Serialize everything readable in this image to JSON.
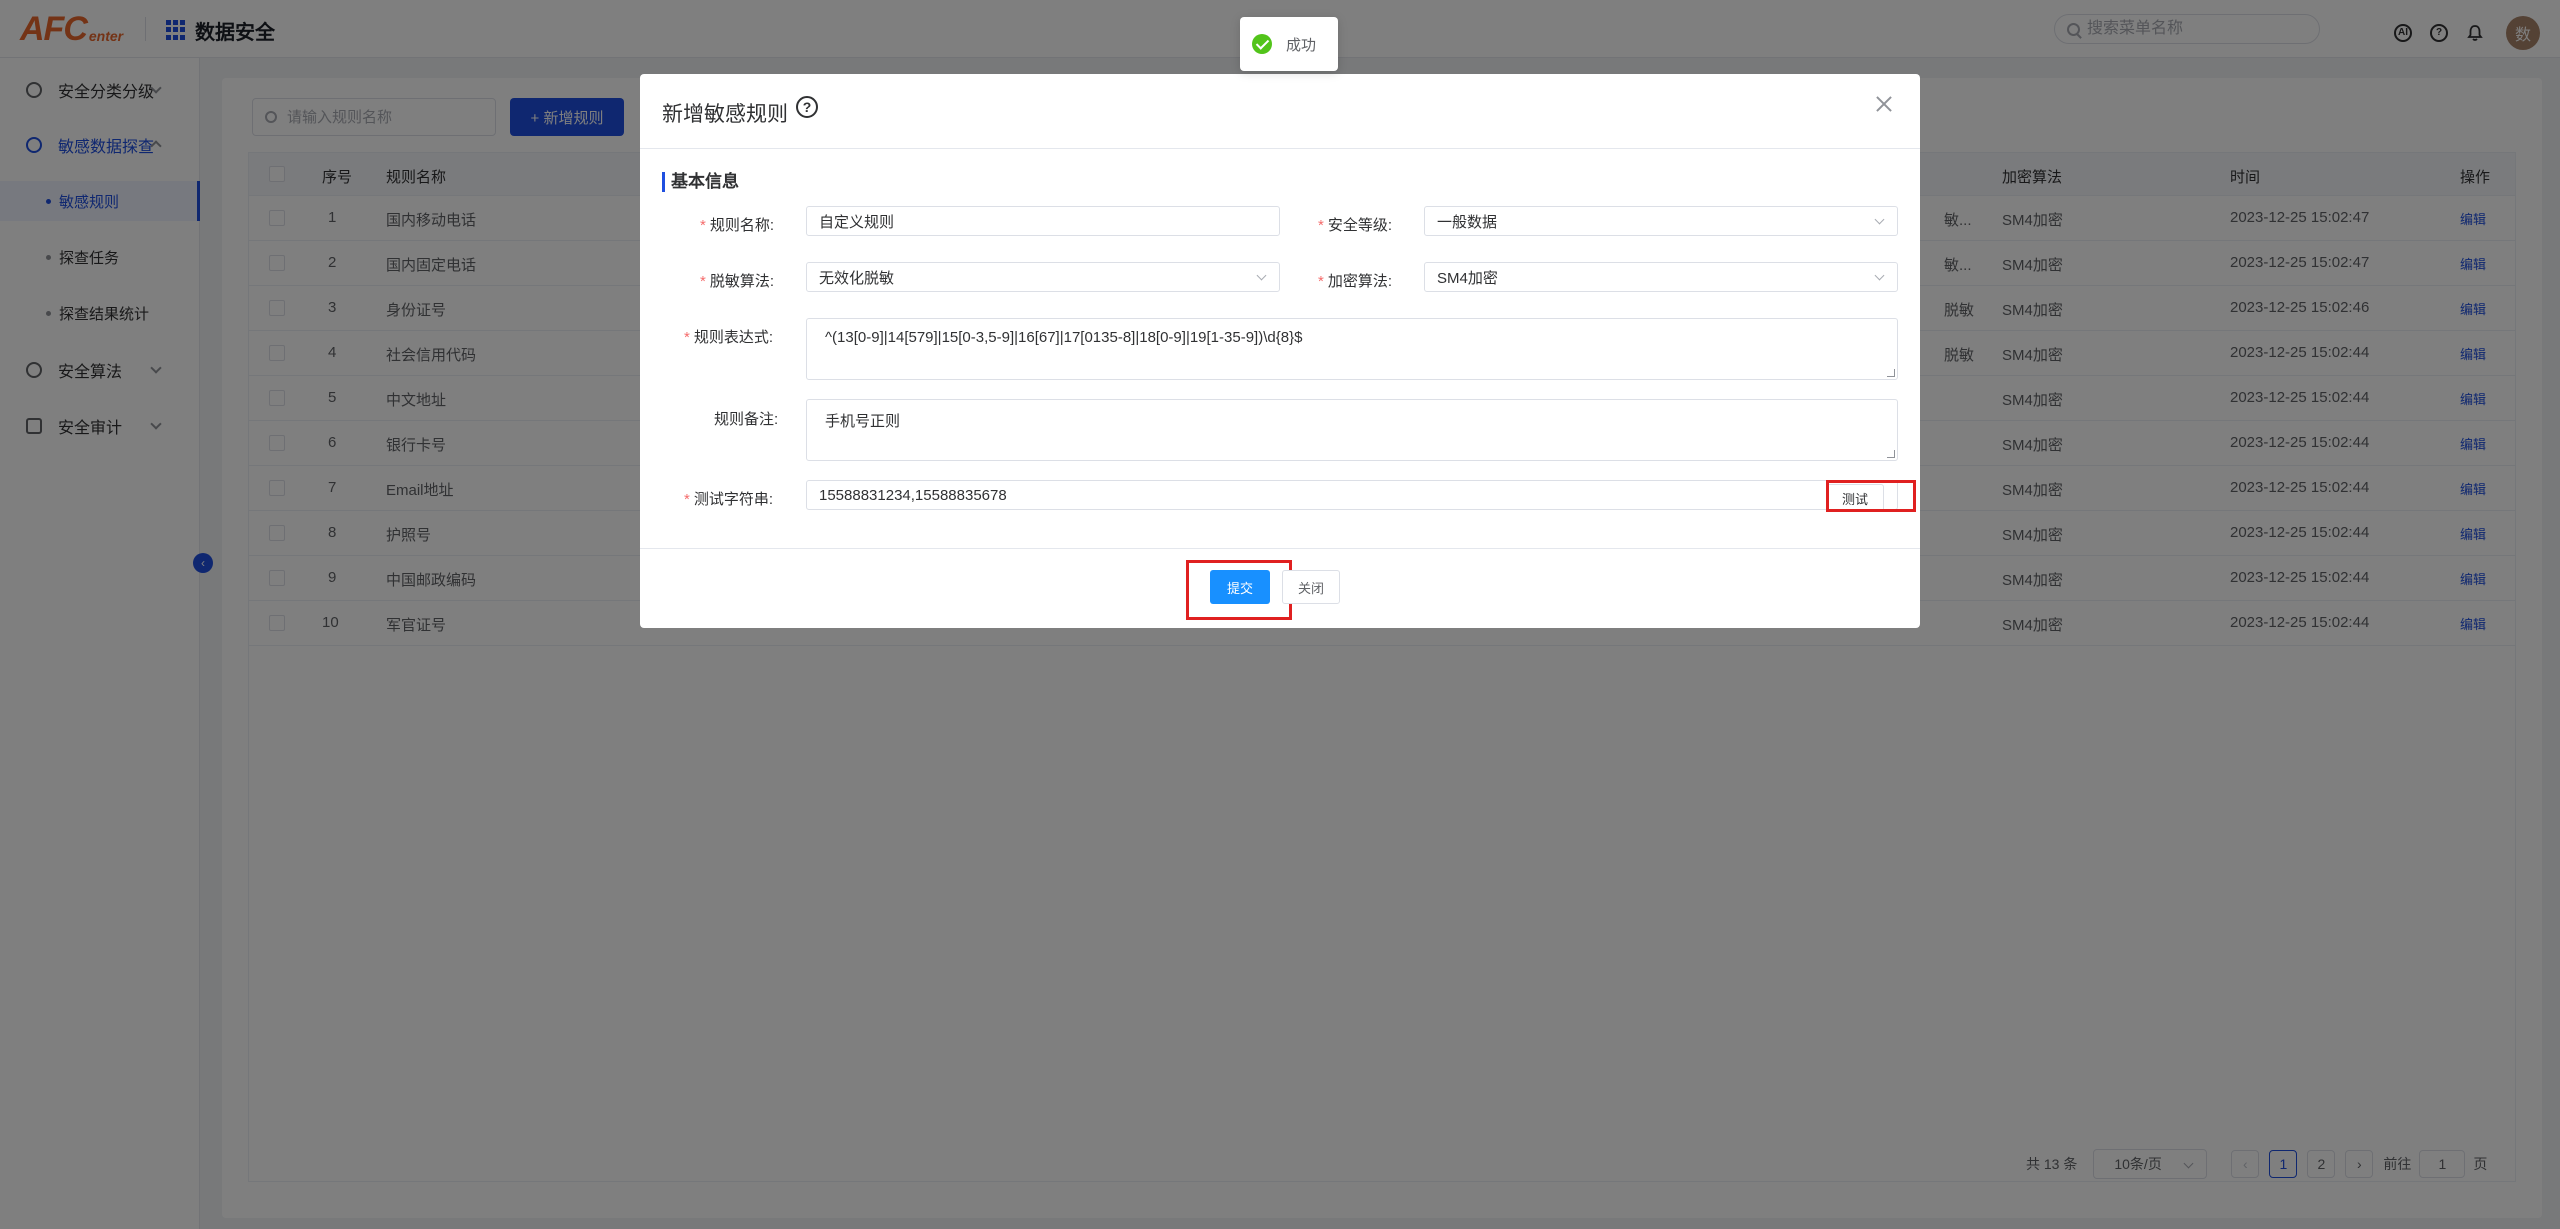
{
  "header": {
    "logo_main": "AFC",
    "logo_sub": "enter",
    "app_title": "数据安全",
    "search_placeholder": "搜索菜单名称",
    "avatar_text": "数"
  },
  "sidebar": {
    "items": [
      {
        "label": "安全分类分级"
      },
      {
        "label": "敏感数据探查"
      },
      {
        "label": "安全算法"
      },
      {
        "label": "安全审计"
      }
    ],
    "subitems": [
      {
        "label": "敏感规则"
      },
      {
        "label": "探查任务"
      },
      {
        "label": "探查结果统计"
      }
    ]
  },
  "toolbar": {
    "search_placeholder": "请输入规则名称",
    "add_label": "+ 新增规则"
  },
  "table": {
    "headers": {
      "index": "序号",
      "name": "规则名称",
      "encrypt": "加密算法",
      "time": "时间",
      "action": "操作"
    },
    "rows": [
      {
        "index": "1",
        "name": "国内移动电话",
        "masking": "敏...",
        "encrypt": "SM4加密",
        "time": "2023-12-25 15:02:47",
        "action": "编辑"
      },
      {
        "index": "2",
        "name": "国内固定电话",
        "masking": "敏...",
        "encrypt": "SM4加密",
        "time": "2023-12-25 15:02:47",
        "action": "编辑"
      },
      {
        "index": "3",
        "name": "身份证号",
        "masking": "脱敏",
        "encrypt": "SM4加密",
        "time": "2023-12-25 15:02:46",
        "action": "编辑"
      },
      {
        "index": "4",
        "name": "社会信用代码",
        "masking": "脱敏",
        "encrypt": "SM4加密",
        "time": "2023-12-25 15:02:44",
        "action": "编辑"
      },
      {
        "index": "5",
        "name": "中文地址",
        "masking": "",
        "encrypt": "SM4加密",
        "time": "2023-12-25 15:02:44",
        "action": "编辑"
      },
      {
        "index": "6",
        "name": "银行卡号",
        "masking": "",
        "encrypt": "SM4加密",
        "time": "2023-12-25 15:02:44",
        "action": "编辑"
      },
      {
        "index": "7",
        "name": "Email地址",
        "masking": "",
        "encrypt": "SM4加密",
        "time": "2023-12-25 15:02:44",
        "action": "编辑"
      },
      {
        "index": "8",
        "name": "护照号",
        "masking": "",
        "encrypt": "SM4加密",
        "time": "2023-12-25 15:02:44",
        "action": "编辑"
      },
      {
        "index": "9",
        "name": "中国邮政编码",
        "masking": "",
        "encrypt": "SM4加密",
        "time": "2023-12-25 15:02:44",
        "action": "编辑"
      },
      {
        "index": "10",
        "name": "军官证号",
        "masking": "",
        "encrypt": "SM4加密",
        "time": "2023-12-25 15:02:44",
        "action": "编辑"
      }
    ]
  },
  "pagination": {
    "total": "共 13 条",
    "page_size": "10条/页",
    "pages": [
      "1",
      "2"
    ],
    "current": "1",
    "goto_label": "前往",
    "goto_value": "1",
    "page_suffix": "页"
  },
  "dialog": {
    "title": "新增敏感规则",
    "section": "基本信息",
    "fields": {
      "rule_name": {
        "label": "规则名称:",
        "value": "自定义规则"
      },
      "security_level": {
        "label": "安全等级:",
        "value": "一般数据"
      },
      "masking_algo": {
        "label": "脱敏算法:",
        "value": "无效化脱敏"
      },
      "encrypt_algo": {
        "label": "加密算法:",
        "value": "SM4加密"
      },
      "regex": {
        "label": "规则表达式:",
        "value": "^(13[0-9]|14[579]|15[0-3,5-9]|16[67]|17[0135-8]|18[0-9]|19[1-35-9])\\d{8}$"
      },
      "remark": {
        "label": "规则备注:",
        "value": "手机号正则"
      },
      "test_string": {
        "label": "测试字符串:",
        "value": "15588831234,15588835678"
      }
    },
    "test_button": "测试",
    "submit_button": "提交",
    "close_button": "关闭"
  },
  "toast": {
    "message": "成功"
  },
  "colors": {
    "primary": "#1f4fe0",
    "submit": "#1890ff",
    "highlight": "#e02020",
    "success": "#52c41a",
    "brand": "#e8672c"
  }
}
